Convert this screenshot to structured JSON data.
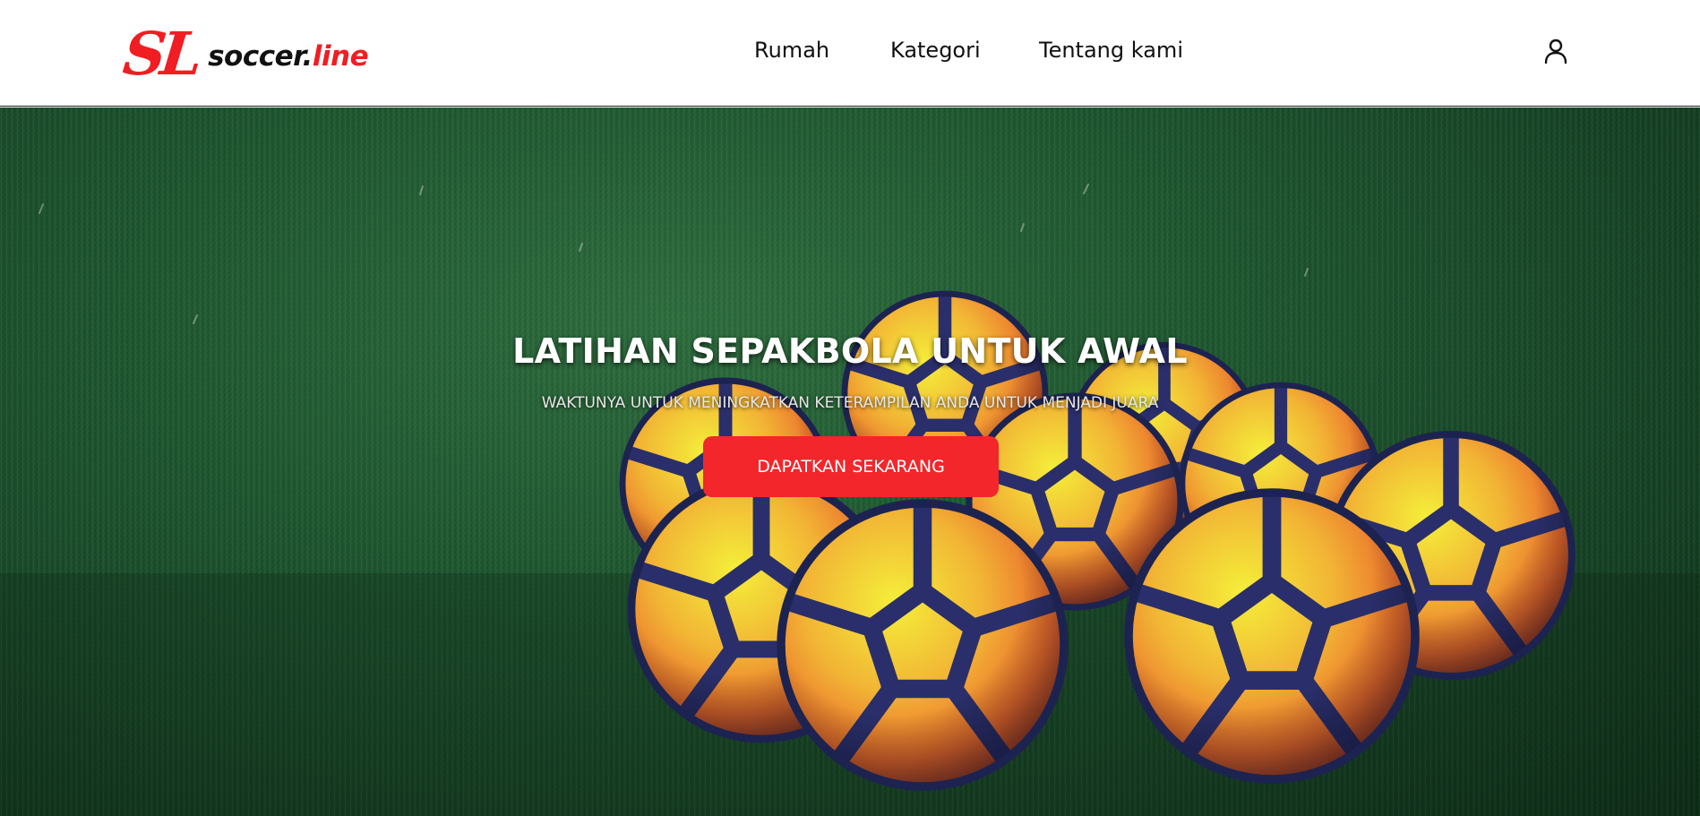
{
  "header": {
    "logo": {
      "mark": "SL",
      "text_main": "soccer.",
      "text_accent": "line"
    },
    "nav": [
      {
        "label": "Rumah"
      },
      {
        "label": "Kategori"
      },
      {
        "label": "Tentang kami"
      }
    ],
    "user_icon": "user-icon"
  },
  "hero": {
    "title": "LATIHAN SEPAKBOLA UNTUK AWAL",
    "subtitle": "WAKTUNYA UNTUK MENINGKATKAN KETERAMPILAN ANDA UNTUK MENJADI JUARA",
    "cta_label": "DAPATKAN SEKARANG",
    "background": "soccer-balls-on-grass"
  },
  "colors": {
    "brand_red": "#f2262b",
    "header_bg": "#ffffff",
    "text_dark": "#111111",
    "grass": "#1f5530"
  }
}
